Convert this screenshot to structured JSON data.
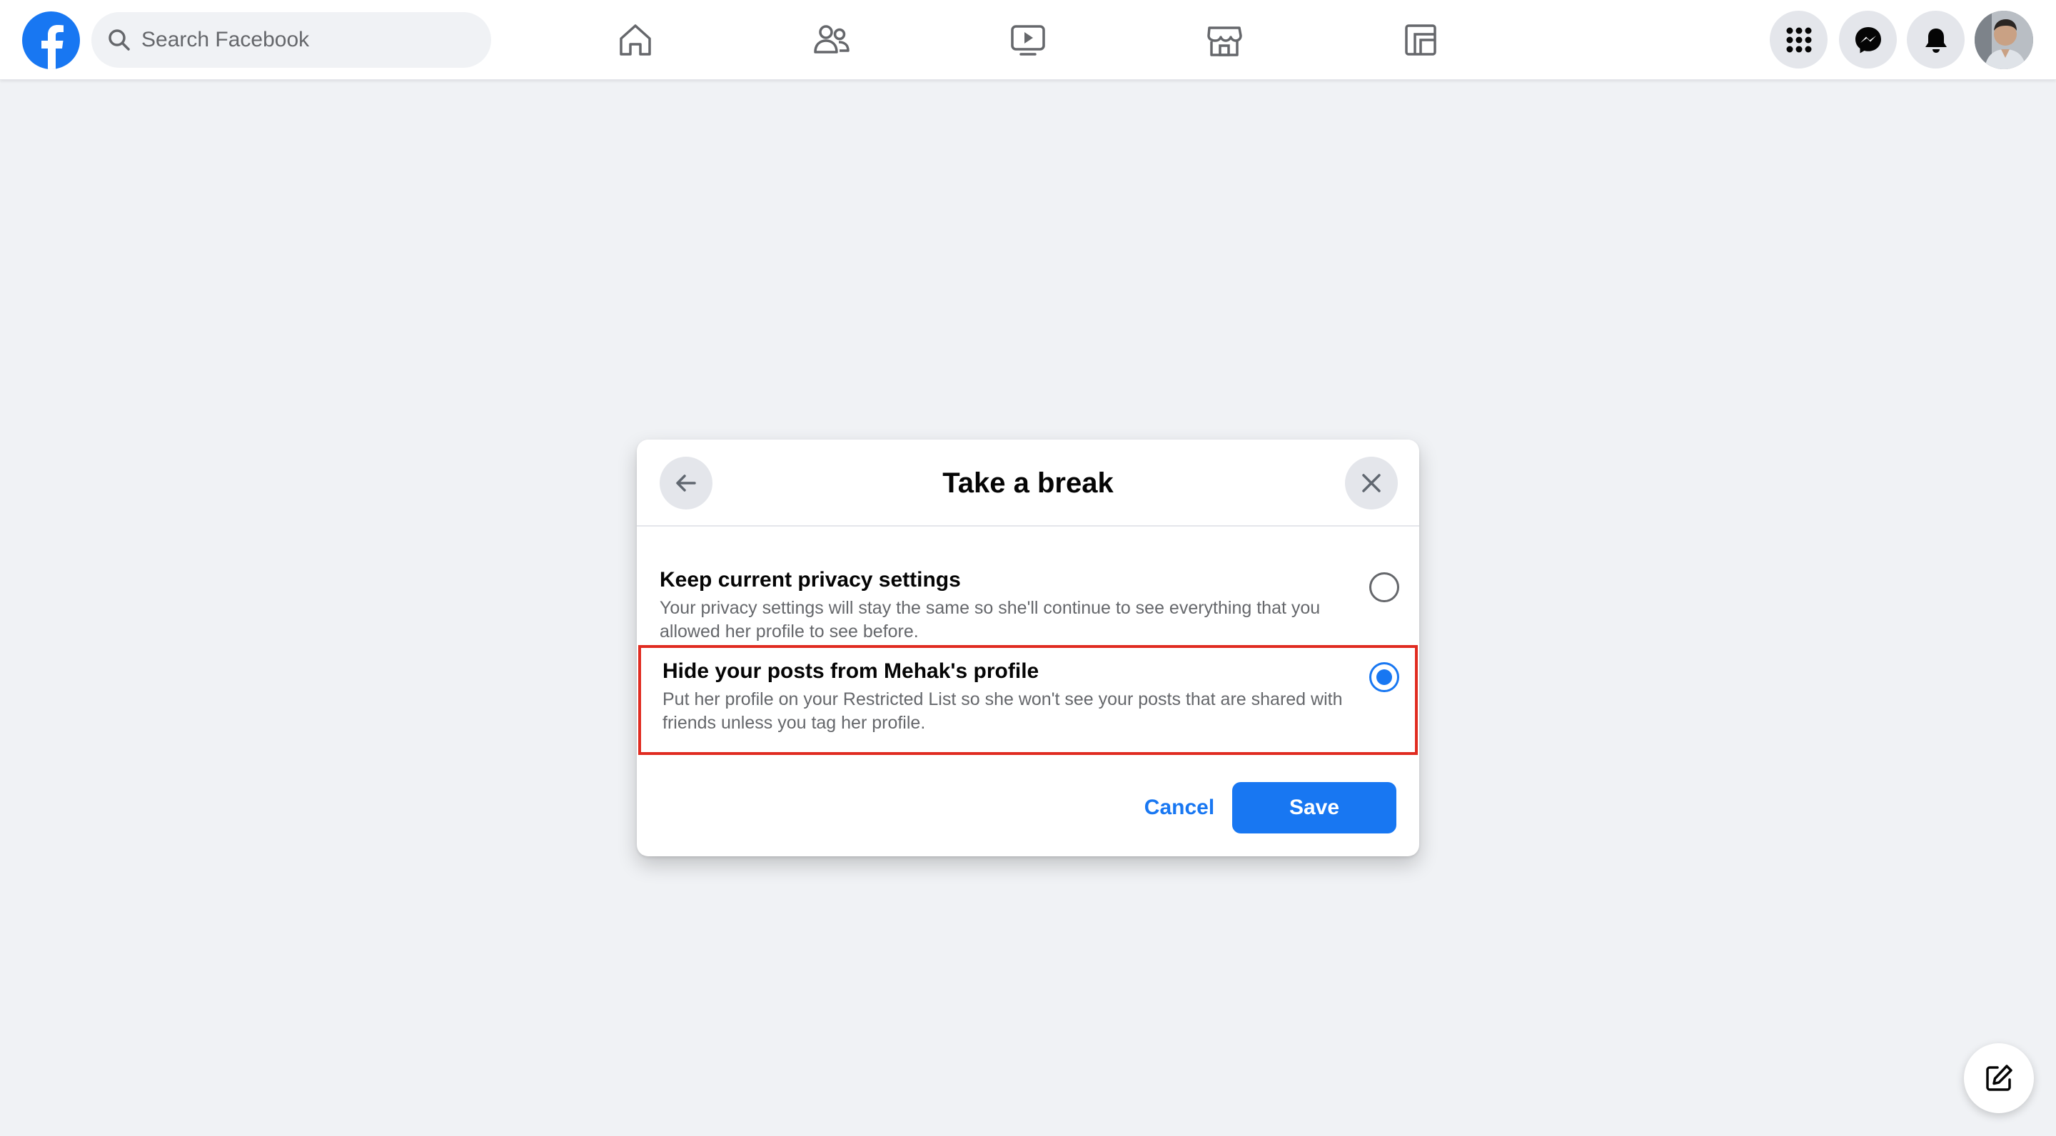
{
  "topbar": {
    "search": {
      "placeholder": "Search Facebook",
      "value": ""
    },
    "nav_tabs": [
      {
        "icon": "home-icon"
      },
      {
        "icon": "friends-icon"
      },
      {
        "icon": "watch-icon"
      },
      {
        "icon": "marketplace-icon"
      },
      {
        "icon": "gaming-icon"
      }
    ],
    "right_buttons": [
      {
        "icon": "menu-grid-icon"
      },
      {
        "icon": "messenger-icon"
      },
      {
        "icon": "notifications-bell-icon"
      },
      {
        "icon": "avatar"
      }
    ]
  },
  "modal": {
    "title": "Take a break",
    "options": [
      {
        "title": "Keep current privacy settings",
        "description": "Your privacy settings will stay the same so she'll continue to see everything that you allowed her profile to see before.",
        "selected": false
      },
      {
        "title": "Hide your posts from Mehak's profile",
        "description": "Put her profile on your Restricted List so she won't see your posts that are shared with friends unless you tag her profile.",
        "selected": true,
        "highlighted": true
      }
    ],
    "cancel_label": "Cancel",
    "save_label": "Save"
  },
  "colors": {
    "brand": "#1877f2",
    "background": "#f0f2f5",
    "highlight_border": "#e02b20",
    "secondary_text": "#65676b"
  }
}
